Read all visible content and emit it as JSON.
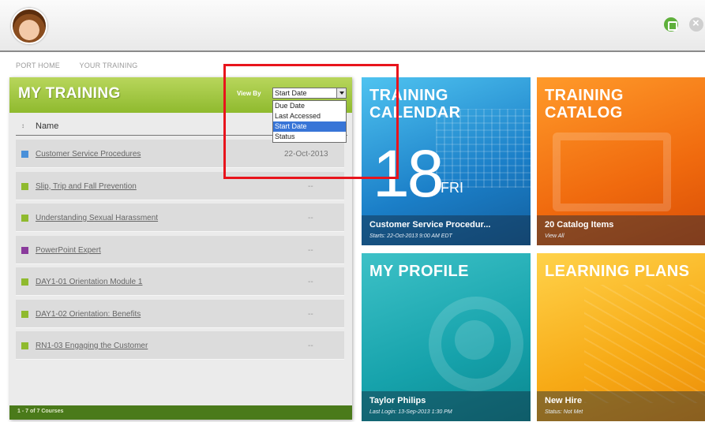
{
  "header": {
    "avatar": "user-avatar",
    "icons": [
      "home-icon",
      "close-icon"
    ]
  },
  "breadcrumb": [
    "PORT HOME",
    "YOUR TRAINING"
  ],
  "training": {
    "title": "MY TRAINING",
    "view_by_label": "View By",
    "select_value": "Start Date",
    "options": [
      "Due Date",
      "Last Accessed",
      "Start Date",
      "Status"
    ],
    "selected_option": "Start Date",
    "sort_glyph": "↕",
    "column_name": "Name",
    "rows": [
      {
        "name": "Customer Service Procedures",
        "value": "22-Oct-2013",
        "icon_color": "#4a90d9"
      },
      {
        "name": "Slip, Trip and Fall Prevention",
        "value": "--",
        "icon_color": "#8fba2e"
      },
      {
        "name": "Understanding Sexual Harassment",
        "value": "--",
        "icon_color": "#8fba2e"
      },
      {
        "name": "PowerPoint Expert",
        "value": "--",
        "icon_color": "#8a3b9c"
      },
      {
        "name": "DAY1-01 Orientation Module 1",
        "value": "--",
        "icon_color": "#8fba2e"
      },
      {
        "name": "DAY1-02 Orientation: Benefits",
        "value": "--",
        "icon_color": "#8fba2e"
      },
      {
        "name": "RN1-03 Engaging the Customer",
        "value": "--",
        "icon_color": "#8fba2e"
      }
    ],
    "footer": "1 - 7 of 7 Courses"
  },
  "tiles": {
    "calendar": {
      "title_1": "TRAINING",
      "title_2": "CALENDAR",
      "day_number": "18",
      "day_name": "FRI",
      "caption": "Customer Service Procedur...",
      "subcaption": "Starts: 22-Oct-2013 9:00 AM EDT"
    },
    "catalog": {
      "title_1": "TRAINING",
      "title_2": "CATALOG",
      "caption": "20 Catalog Items",
      "subcaption": "View All"
    },
    "profile": {
      "title_1": "MY PROFILE",
      "caption": "Taylor Philips",
      "subcaption": "Last Login: 13-Sep-2013 1:30 PM"
    },
    "plans": {
      "title_1": "LEARNING PLANS",
      "caption": "New Hire",
      "subcaption": "Status: Not Met"
    }
  },
  "colors": {
    "green_header": "#8fba2e",
    "calendar_tile": "#1b7fc8",
    "catalog_tile": "#f06a0e",
    "profile_tile": "#16a2ab",
    "plans_tile": "#f7aa16",
    "highlight": "#e8141c"
  }
}
